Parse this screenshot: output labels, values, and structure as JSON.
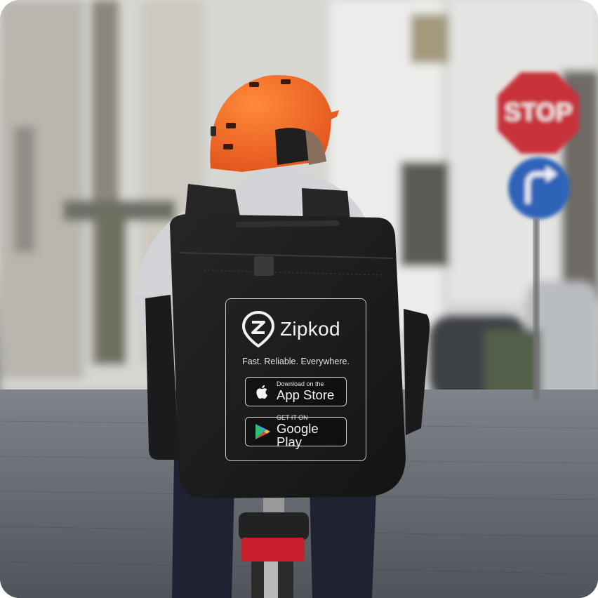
{
  "brand": {
    "name": "Zipkod",
    "tagline": "Fast. Reliable. Everywhere."
  },
  "stores": {
    "apple": {
      "small": "Download on the",
      "big": "App Store",
      "icon": "apple-icon"
    },
    "google": {
      "small": "GET IT ON",
      "big": "Google Play",
      "icon": "google-play-icon"
    }
  },
  "sign": {
    "text": "STOP"
  },
  "colors": {
    "helmet": "#f05a1c",
    "bag": "#1c1c1c",
    "stop_sign": "#c8303a",
    "blue_sign": "#2f63b8"
  }
}
